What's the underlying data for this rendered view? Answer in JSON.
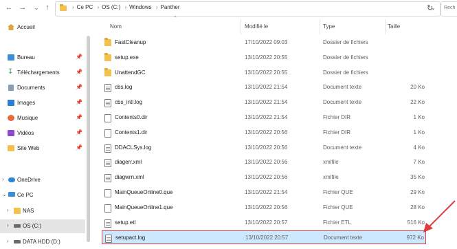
{
  "address": {
    "breadcrumbs": [
      "Ce PC",
      "OS (C:)",
      "Windows",
      "Panther"
    ],
    "search_placeholder": "Rech"
  },
  "sidebar": {
    "items": [
      {
        "label": "Accueil",
        "icon": "home-icon",
        "pinned": false
      },
      {
        "label": "Bureau",
        "icon": "desktop-icon",
        "pinned": true
      },
      {
        "label": "Téléchargements",
        "icon": "download-icon",
        "pinned": true
      },
      {
        "label": "Documents",
        "icon": "documents-icon",
        "pinned": true
      },
      {
        "label": "Images",
        "icon": "images-icon",
        "pinned": true
      },
      {
        "label": "Musique",
        "icon": "music-icon",
        "pinned": true
      },
      {
        "label": "Vidéos",
        "icon": "videos-icon",
        "pinned": true
      },
      {
        "label": "Site Web",
        "icon": "folder-icon",
        "pinned": true
      },
      {
        "label": "OneDrive",
        "icon": "cloud-icon",
        "pinned": false
      },
      {
        "label": "Ce PC",
        "icon": "pc-icon",
        "pinned": false
      },
      {
        "label": "NAS",
        "icon": "folder-icon",
        "pinned": false
      },
      {
        "label": "OS (C:)",
        "icon": "drive-icon",
        "pinned": false,
        "selected": true
      },
      {
        "label": "DATA HDD (D:)",
        "icon": "drive-icon",
        "pinned": false
      }
    ]
  },
  "columns": {
    "name": "Nom",
    "modified": "Modifié le",
    "type": "Type",
    "size": "Taille"
  },
  "files": [
    {
      "name": "FastCleanup",
      "date": "17/10/2022 09:03",
      "type": "Dossier de fichiers",
      "size": "",
      "icon": "folder"
    },
    {
      "name": "setup.exe",
      "date": "13/10/2022 20:55",
      "type": "Dossier de fichiers",
      "size": "",
      "icon": "folder"
    },
    {
      "name": "UnattendGC",
      "date": "13/10/2022 20:55",
      "type": "Dossier de fichiers",
      "size": "",
      "icon": "folder"
    },
    {
      "name": "cbs.log",
      "date": "13/10/2022 21:54",
      "type": "Document texte",
      "size": "20 Ko",
      "icon": "doc"
    },
    {
      "name": "cbs_intl.log",
      "date": "13/10/2022 21:54",
      "type": "Document texte",
      "size": "22 Ko",
      "icon": "doc"
    },
    {
      "name": "Contents0.dir",
      "date": "13/10/2022 21:54",
      "type": "Fichier DIR",
      "size": "1 Ko",
      "icon": "blank"
    },
    {
      "name": "Contents1.dir",
      "date": "13/10/2022 20:56",
      "type": "Fichier DIR",
      "size": "1 Ko",
      "icon": "blank"
    },
    {
      "name": "DDACLSys.log",
      "date": "13/10/2022 20:56",
      "type": "Document texte",
      "size": "4 Ko",
      "icon": "doc"
    },
    {
      "name": "diagerr.xml",
      "date": "13/10/2022 20:56",
      "type": "xmlfile",
      "size": "7 Ko",
      "icon": "doc"
    },
    {
      "name": "diagwrn.xml",
      "date": "13/10/2022 20:56",
      "type": "xmlfile",
      "size": "35 Ko",
      "icon": "doc"
    },
    {
      "name": "MainQueueOnline0.que",
      "date": "13/10/2022 21:54",
      "type": "Fichier QUE",
      "size": "29 Ko",
      "icon": "blank"
    },
    {
      "name": "MainQueueOnline1.que",
      "date": "13/10/2022 20:56",
      "type": "Fichier QUE",
      "size": "28 Ko",
      "icon": "blank"
    },
    {
      "name": "setup.etl",
      "date": "13/10/2022 20:57",
      "type": "Fichier ETL",
      "size": "516 Ko",
      "icon": "doc"
    },
    {
      "name": "setupact.log",
      "date": "13/10/2022 20:57",
      "type": "Document texte",
      "size": "972 Ko",
      "icon": "doc",
      "highlighted": true
    }
  ],
  "colors": {
    "accent": "#e23b3b",
    "selection": "#cce8ff",
    "folder": "#f2c14e"
  }
}
